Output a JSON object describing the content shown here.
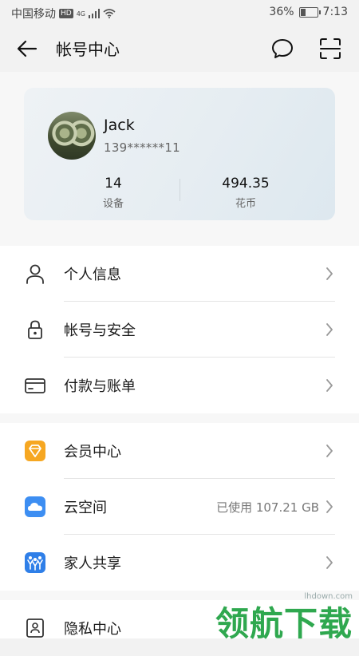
{
  "status_bar": {
    "carrier": "中国移动",
    "hd_badge": "HD",
    "network_type": "4G",
    "battery_percent": "36%",
    "battery_level": 0.36,
    "time": "7:13"
  },
  "header": {
    "title": "帐号中心",
    "back_icon": "back-arrow-icon",
    "message_icon": "message-bubble-icon",
    "scan_icon": "scan-icon"
  },
  "profile": {
    "name": "Jack",
    "phone": "139******11",
    "stats": [
      {
        "value": "14",
        "label": "设备"
      },
      {
        "value": "494.35",
        "label": "花币"
      }
    ]
  },
  "menu_group_1": [
    {
      "label": "个人信息",
      "icon": "person-icon"
    },
    {
      "label": "帐号与安全",
      "icon": "lock-icon"
    },
    {
      "label": "付款与账单",
      "icon": "credit-card-icon"
    }
  ],
  "menu_group_2": [
    {
      "label": "会员中心",
      "icon": "diamond-icon",
      "color": "#f5a623"
    },
    {
      "label": "云空间",
      "icon": "cloud-icon",
      "color": "#3a8cf0",
      "value": "已使用 107.21 GB"
    },
    {
      "label": "家人共享",
      "icon": "family-icon",
      "color": "#2f7fe8"
    }
  ],
  "menu_group_3": [
    {
      "label": "隐私中心",
      "icon": "privacy-icon"
    }
  ],
  "watermark": {
    "url": "lhdown.com",
    "text": "领航下载",
    "color": "#2fa84f"
  }
}
